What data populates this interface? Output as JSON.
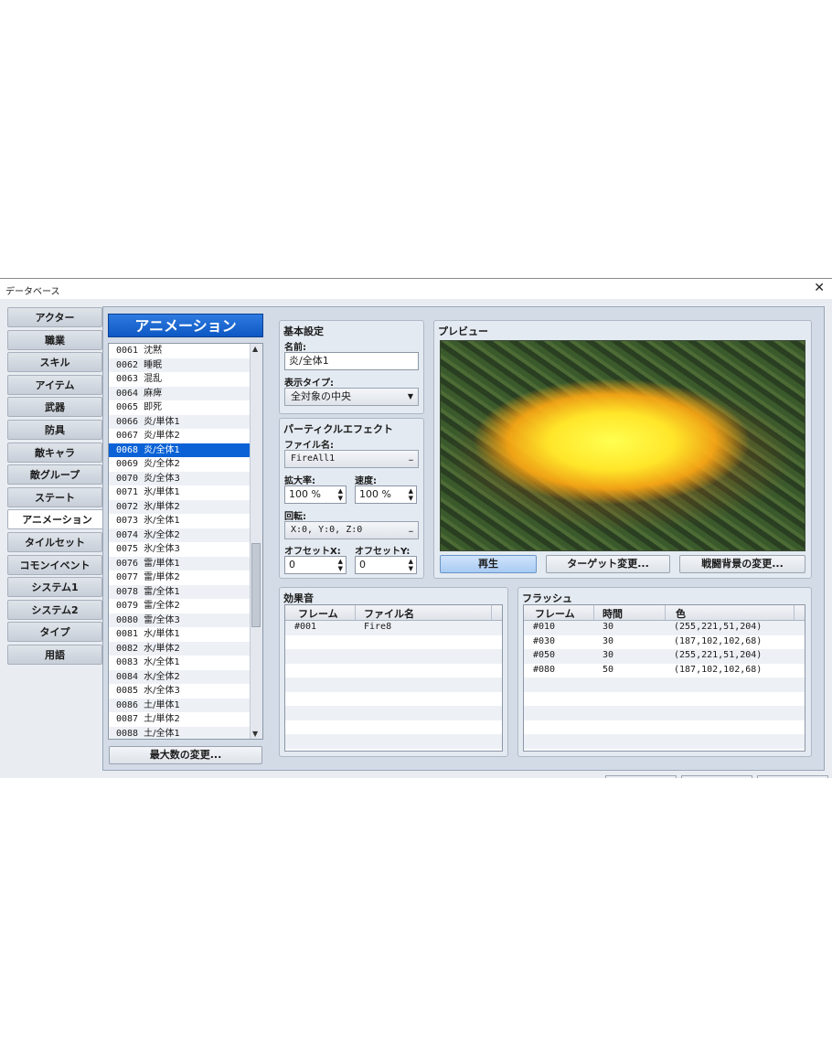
{
  "window": {
    "title": "データベース",
    "close": "✕"
  },
  "tabs": [
    "アクター",
    "職業",
    "スキル",
    "アイテム",
    "武器",
    "防具",
    "敵キャラ",
    "敵グループ",
    "ステート",
    "アニメーション",
    "タイルセット",
    "コモンイベント",
    "システム1",
    "システム2",
    "タイプ",
    "用語"
  ],
  "active_tab_index": 9,
  "list": {
    "title": "アニメーション",
    "selected_id": "0068",
    "items": [
      {
        "id": "0061",
        "name": "沈黙"
      },
      {
        "id": "0062",
        "name": "睡眠"
      },
      {
        "id": "0063",
        "name": "混乱"
      },
      {
        "id": "0064",
        "name": "麻痺"
      },
      {
        "id": "0065",
        "name": "即死"
      },
      {
        "id": "0066",
        "name": "炎/単体1"
      },
      {
        "id": "0067",
        "name": "炎/単体2"
      },
      {
        "id": "0068",
        "name": "炎/全体1"
      },
      {
        "id": "0069",
        "name": "炎/全体2"
      },
      {
        "id": "0070",
        "name": "炎/全体3"
      },
      {
        "id": "0071",
        "name": "氷/単体1"
      },
      {
        "id": "0072",
        "name": "氷/単体2"
      },
      {
        "id": "0073",
        "name": "氷/全体1"
      },
      {
        "id": "0074",
        "name": "氷/全体2"
      },
      {
        "id": "0075",
        "name": "氷/全体3"
      },
      {
        "id": "0076",
        "name": "雷/単体1"
      },
      {
        "id": "0077",
        "name": "雷/単体2"
      },
      {
        "id": "0078",
        "name": "雷/全体1"
      },
      {
        "id": "0079",
        "name": "雷/全体2"
      },
      {
        "id": "0080",
        "name": "雷/全体3"
      },
      {
        "id": "0081",
        "name": "水/単体1"
      },
      {
        "id": "0082",
        "name": "水/単体2"
      },
      {
        "id": "0083",
        "name": "水/全体1"
      },
      {
        "id": "0084",
        "name": "水/全体2"
      },
      {
        "id": "0085",
        "name": "水/全体3"
      },
      {
        "id": "0086",
        "name": "土/単体1"
      },
      {
        "id": "0087",
        "name": "土/単体2"
      },
      {
        "id": "0088",
        "name": "土/全体1"
      }
    ],
    "max_button": "最大数の変更..."
  },
  "basic": {
    "header": "基本設定",
    "name_label": "名前:",
    "name_value": "炎/全体1",
    "display_label": "表示タイプ:",
    "display_value": "全対象の中央"
  },
  "particle": {
    "header": "パーティクルエフェクト",
    "file_label": "ファイル名:",
    "file_value": "FireAll1",
    "scale_label": "拡大率:",
    "scale_value": "100 %",
    "speed_label": "速度:",
    "speed_value": "100 %",
    "rotation_label": "回転:",
    "rotation_value": "X:0, Y:0, Z:0",
    "offx_label": "オフセットX:",
    "offx_value": "0",
    "offy_label": "オフセットY:",
    "offy_value": "0",
    "ellipsis": "…"
  },
  "preview": {
    "header": "プレビュー",
    "play": "再生",
    "target": "ターゲット変更...",
    "background": "戦闘背景の変更..."
  },
  "sound": {
    "header": "効果音",
    "col_frame": "フレーム",
    "col_file": "ファイル名",
    "rows": [
      {
        "frame": "#001",
        "file": "Fire8"
      }
    ]
  },
  "flash": {
    "header": "フラッシュ",
    "col_frame": "フレーム",
    "col_time": "時間",
    "col_color": "色",
    "rows": [
      {
        "frame": "#010",
        "time": "30",
        "color": "(255,221,51,204)"
      },
      {
        "frame": "#030",
        "time": "30",
        "color": "(187,102,102,68)"
      },
      {
        "frame": "#050",
        "time": "30",
        "color": "(255,221,51,204)"
      },
      {
        "frame": "#080",
        "time": "50",
        "color": "(187,102,102,68)"
      }
    ]
  }
}
